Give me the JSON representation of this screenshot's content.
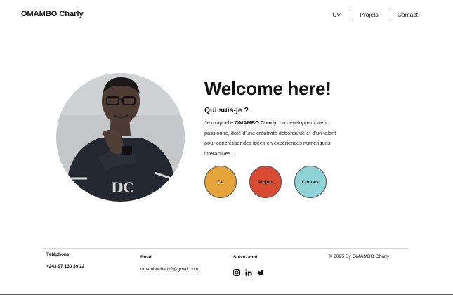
{
  "header": {
    "brand": "OMAMBO Charly",
    "nav": [
      {
        "label": "CV"
      },
      {
        "label": "Projets"
      },
      {
        "label": "Contact"
      }
    ]
  },
  "hero": {
    "title": "Welcome here!",
    "subtitle": "Qui suis-je ?",
    "bio_prefix": "Je m'appelle ",
    "bio_name": "OMAMBO Charly",
    "bio_rest": ", un développeur web, passionné, doté d'une créativité débordante et d'un talent pour concrétiser des idées en expériences numériques interactives.",
    "buttons": [
      {
        "label": "CV",
        "color": "#e6a53a"
      },
      {
        "label": "Projets",
        "color": "#d94a33"
      },
      {
        "label": "Contact",
        "color": "#8fd3d7"
      }
    ]
  },
  "footer": {
    "phone_label": "Téléphone",
    "phone_value": "+243 97 130 39 22",
    "email_label": "Email",
    "email_value": "omambocharly2@gmail.com",
    "social_label": "Suivez-moi",
    "social_icons": [
      "instagram-icon",
      "linkedin-icon",
      "twitter-icon"
    ],
    "copyright": "© 2025 By OMAMBO Charly"
  }
}
